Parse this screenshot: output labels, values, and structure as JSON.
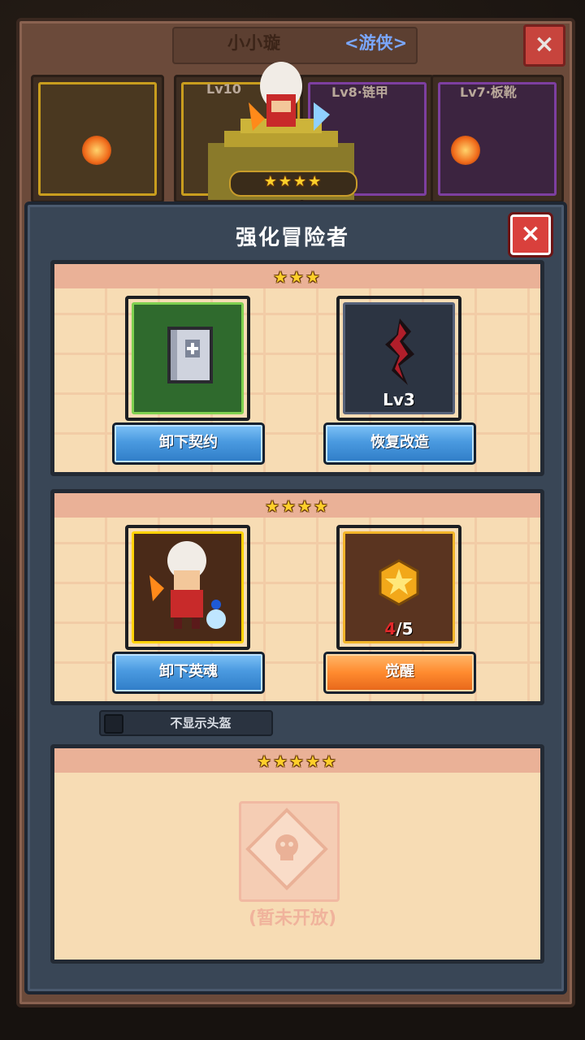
{
  "character": {
    "name": "小小璇",
    "class": "<游侠>"
  },
  "equipment": [
    {
      "label": ""
    },
    {
      "label": "Lv10"
    },
    {
      "label": "Lv8·链甲"
    },
    {
      "label": "Lv7·板靴"
    }
  ],
  "hero_stars": "★★★★",
  "modal": {
    "title": "强化冒险者",
    "close_icon": "close-icon"
  },
  "tier3": {
    "stars": "★★★",
    "slot1": {
      "icon": "contract-book-icon",
      "button": "卸下契约"
    },
    "slot2": {
      "icon": "dark-whip-icon",
      "level": "Lv3",
      "button": "恢复改造"
    }
  },
  "tier4": {
    "stars": "★★★★",
    "slot1": {
      "icon": "hero-soul-icon",
      "button": "卸下英魂"
    },
    "slot2": {
      "icon": "star-medal-icon",
      "count_current": "4",
      "count_total": "/5",
      "button": "觉醒"
    }
  },
  "toggle": {
    "label": "不显示头盔",
    "checked": false
  },
  "tier5": {
    "stars": "★★★★★",
    "locked_text": "(暂未开放)"
  },
  "colors": {
    "modal_bg": "#394656",
    "tier_bg": "#f7dcb4",
    "blue_button": "#4a9ae0",
    "orange_button": "#ff8a2e",
    "close_red": "#d9403c",
    "star_gold": "#ffcf2a"
  }
}
